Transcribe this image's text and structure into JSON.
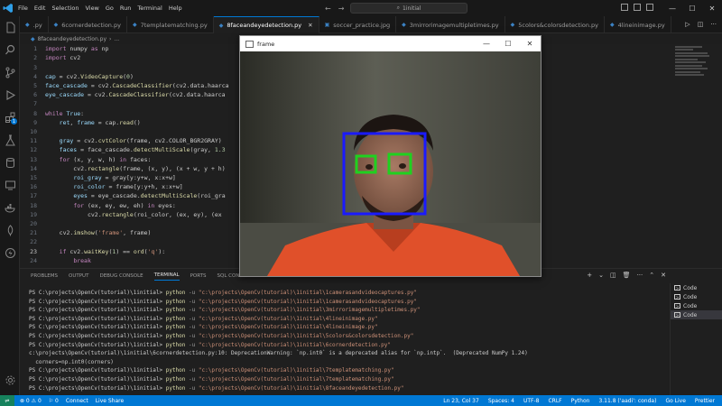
{
  "menu": [
    "File",
    "Edit",
    "Selection",
    "View",
    "Go",
    "Run",
    "Terminal",
    "Help"
  ],
  "search_text": "1initial",
  "tabs": [
    {
      "label": ".py",
      "active": false
    },
    {
      "label": "6cornerdetection.py",
      "active": false
    },
    {
      "label": "7templatematching.py",
      "active": false
    },
    {
      "label": "8faceandeyedetection.py",
      "active": true
    },
    {
      "label": "soccer_practice.jpg",
      "active": false
    },
    {
      "label": "3mirrorimagemultipletimes.py",
      "active": false
    },
    {
      "label": "5colors&colorsdetection.py",
      "active": false
    },
    {
      "label": "4lineinimage.py",
      "active": false
    }
  ],
  "breadcrumb": {
    "file": "8faceandeyedetection.py",
    "more": "..."
  },
  "code_lines": [
    {
      "n": "1",
      "html": "<span class='kw'>import</span> numpy <span class='kw'>as</span> np"
    },
    {
      "n": "2",
      "html": "<span class='kw'>import</span> cv2"
    },
    {
      "n": "3",
      "html": ""
    },
    {
      "n": "4",
      "html": "<span class='var'>cap</span> = cv2.<span class='fn'>VideoCapture</span>(<span class='num'>0</span>)"
    },
    {
      "n": "5",
      "html": "<span class='var'>face_cascade</span> = cv2.<span class='fn'>CascadeClassifier</span>(cv2.data.haarca"
    },
    {
      "n": "6",
      "html": "<span class='var'>eye_cascade</span> = cv2.<span class='fn'>CascadeClassifier</span>(cv2.data.haarca"
    },
    {
      "n": "7",
      "html": ""
    },
    {
      "n": "8",
      "html": "<span class='kw'>while</span> <span class='var'>True</span>:"
    },
    {
      "n": "9",
      "html": "    <span class='var'>ret</span>, <span class='var'>frame</span> = cap.<span class='fn'>read</span>()"
    },
    {
      "n": "10",
      "html": ""
    },
    {
      "n": "11",
      "html": "    <span class='var'>gray</span> = cv2.<span class='fn'>cvtColor</span>(frame, cv2.COLOR_BGR2GRAY)"
    },
    {
      "n": "12",
      "html": "    <span class='var'>faces</span> = face_cascade.<span class='fn'>detectMultiScale</span>(gray, <span class='num'>1.3</span>"
    },
    {
      "n": "13",
      "html": "    <span class='kw'>for</span> (x, y, w, h) <span class='kw'>in</span> faces:"
    },
    {
      "n": "14",
      "html": "        cv2.<span class='fn'>rectangle</span>(frame, (x, y), (x + w, y + h)"
    },
    {
      "n": "15",
      "html": "        <span class='var'>roi_gray</span> = gray[y:y+w, x:x+w]"
    },
    {
      "n": "16",
      "html": "        <span class='var'>roi_color</span> = frame[y:y+h, x:x+w]"
    },
    {
      "n": "17",
      "html": "        <span class='var'>eyes</span> = eye_cascade.<span class='fn'>detectMultiScale</span>(roi_gra"
    },
    {
      "n": "18",
      "html": "        <span class='kw'>for</span> (ex, ey, ew, eh) <span class='kw'>in</span> eyes:"
    },
    {
      "n": "19",
      "html": "            cv2.<span class='fn'>rectangle</span>(roi_color, (ex, ey), (ex"
    },
    {
      "n": "20",
      "html": ""
    },
    {
      "n": "21",
      "html": "    cv2.<span class='fn'>imshow</span>(<span class='str'>'frame'</span>, frame)"
    },
    {
      "n": "22",
      "html": ""
    },
    {
      "n": "23",
      "html": "    <span class='kw'>if</span> cv2.<span class='fn'>waitKey</span>(<span class='num'>1</span>) == <span class='fn'>ord</span>(<span class='str'>'q'</span>):"
    },
    {
      "n": "24",
      "html": "        <span class='kw'>break</span>"
    }
  ],
  "panel_tabs": [
    "PROBLEMS",
    "OUTPUT",
    "DEBUG CONSOLE",
    "TERMINAL",
    "PORTS",
    "SQL CONSOLE"
  ],
  "terminal_lines": [
    "PS C:\\projects\\OpenCv(tutorial)\\1initial> <span class='cmd'>python</span> <span class='flag'>-u</span> <span class='path'>\"c:\\projects\\OpenCv(tutorial)\\1initial\\1camerasandvideocaptures.py\"</span>",
    "PS C:\\projects\\OpenCv(tutorial)\\1initial> <span class='cmd'>python</span> <span class='flag'>-u</span> <span class='path'>\"c:\\projects\\OpenCv(tutorial)\\1initial\\1camerasandvideocaptures.py\"</span>",
    "PS C:\\projects\\OpenCv(tutorial)\\1initial> <span class='cmd'>python</span> <span class='flag'>-u</span> <span class='path'>\"c:\\projects\\OpenCv(tutorial)\\1initial\\3mirrorimagemultipletimes.py\"</span>",
    "PS C:\\projects\\OpenCv(tutorial)\\1initial> <span class='cmd'>python</span> <span class='flag'>-u</span> <span class='path'>\"c:\\projects\\OpenCv(tutorial)\\1initial\\4lineinimage.py\"</span>",
    "PS C:\\projects\\OpenCv(tutorial)\\1initial> <span class='cmd'>python</span> <span class='flag'>-u</span> <span class='path'>\"c:\\projects\\OpenCv(tutorial)\\1initial\\4lineinimage.py\"</span>",
    "PS C:\\projects\\OpenCv(tutorial)\\1initial> <span class='cmd'>python</span> <span class='flag'>-u</span> <span class='path'>\"c:\\projects\\OpenCv(tutorial)\\1initial\\5colors&colorsdetection.py\"</span>",
    "PS C:\\projects\\OpenCv(tutorial)\\1initial> <span class='cmd'>python</span> <span class='flag'>-u</span> <span class='path'>\"c:\\projects\\OpenCv(tutorial)\\1initial\\6cornerdetection.py\"</span>",
    "c:\\projects\\OpenCv(tutorial)\\1initial\\6cornerdetection.py:10: DeprecationWarning: `np.int0` is a deprecated alias for `np.intp`.  (Deprecated NumPy 1.24)",
    "  corners=np.int0(corners)",
    "PS C:\\projects\\OpenCv(tutorial)\\1initial> <span class='cmd'>python</span> <span class='flag'>-u</span> <span class='path'>\"c:\\projects\\OpenCv(tutorial)\\1initial\\7templatematching.py\"</span>",
    "PS C:\\projects\\OpenCv(tutorial)\\1initial> <span class='cmd'>python</span> <span class='flag'>-u</span> <span class='path'>\"c:\\projects\\OpenCv(tutorial)\\1initial\\7templatematching.py\"</span>",
    "PS C:\\projects\\OpenCv(tutorial)\\1initial> <span class='cmd'>python</span> <span class='flag'>-u</span> <span class='path'>\"c:\\projects\\OpenCv(tutorial)\\1initial\\8faceandeyedetection.py\"</span>"
  ],
  "terminal_list": [
    {
      "label": "Code",
      "active": false
    },
    {
      "label": "Code",
      "active": false
    },
    {
      "label": "Code",
      "active": false
    },
    {
      "label": "Code",
      "active": true
    }
  ],
  "status_left": [
    "⊗ 0 ⚠ 0",
    "⚐ 0",
    "Connect",
    "Live Share"
  ],
  "status_right": [
    "Ln 23, Col 37",
    "Spaces: 4",
    "UTF-8",
    "CRLF",
    "Python",
    "3.11.8 ('aadi': conda)",
    "Go Live",
    "Prettier"
  ],
  "frame_window": {
    "title": "frame"
  },
  "colors": {
    "accent": "#0078d4",
    "face_box": "#1a1aff",
    "eye_box": "#1fd11f",
    "shirt": "#e0502a"
  }
}
